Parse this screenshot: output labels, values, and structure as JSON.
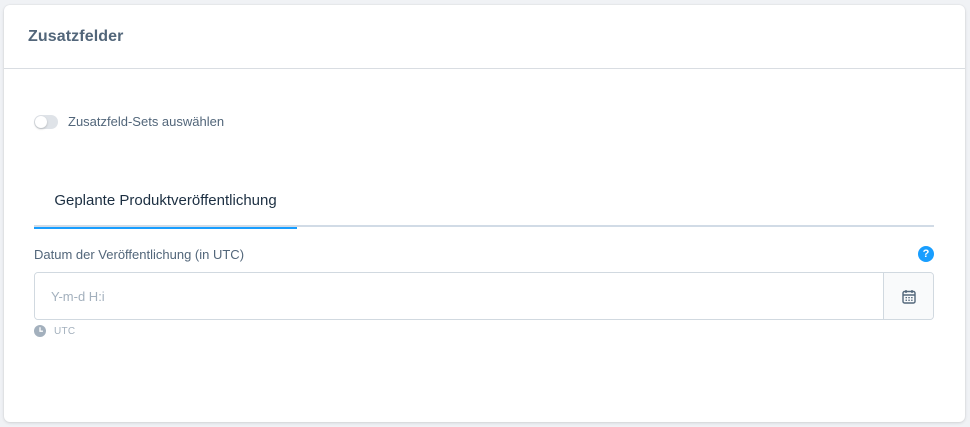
{
  "card": {
    "title": "Zusatzfelder"
  },
  "toggle": {
    "label": "Zusatzfeld-Sets auswählen",
    "checked": false
  },
  "tabs": [
    {
      "label": "Geplante Produktveröffentlichung",
      "active": true
    }
  ],
  "field": {
    "label": "Datum der Veröffentlichung (in UTC)",
    "value": "",
    "placeholder": "Y-m-d H:i",
    "help_icon_text": "?",
    "hint": "UTC"
  },
  "icons": {
    "help": "question-circle-icon",
    "calendar": "calendar-icon",
    "timezone": "clock-icon"
  },
  "colors": {
    "accent": "#189eff",
    "text": "#52667a",
    "muted": "#a3b0bd"
  }
}
